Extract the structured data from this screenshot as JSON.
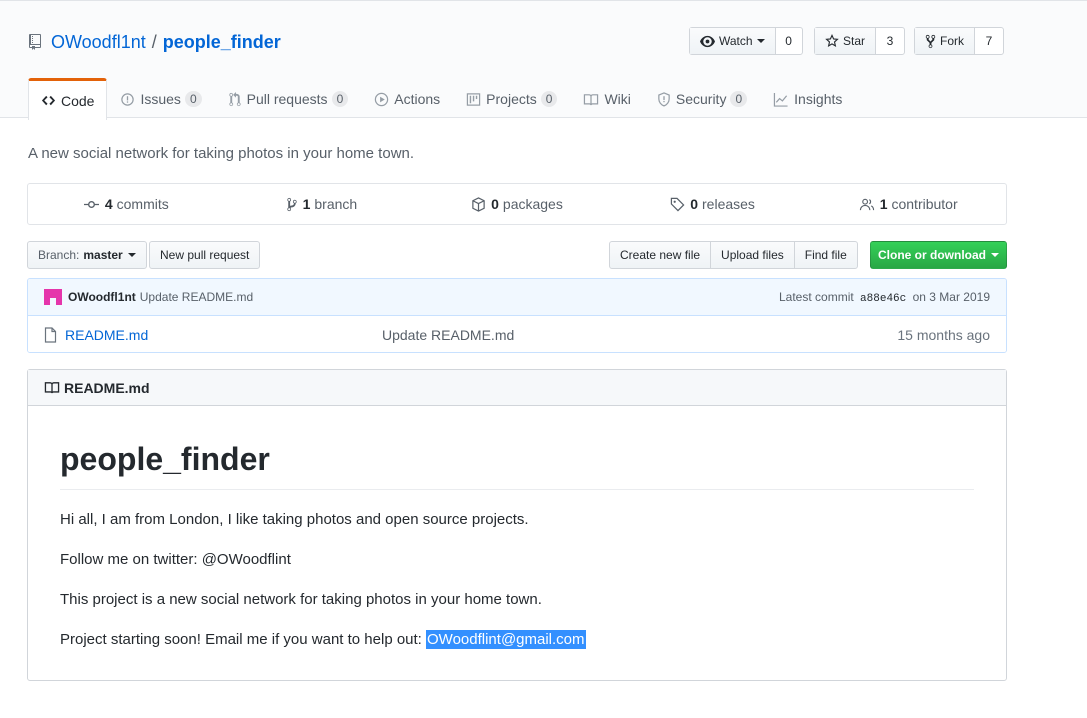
{
  "repo": {
    "owner": "OWoodfl1nt",
    "separator": "/",
    "name": "people_finder"
  },
  "actions": {
    "watch": {
      "label": "Watch",
      "count": "0"
    },
    "star": {
      "label": "Star",
      "count": "3"
    },
    "fork": {
      "label": "Fork",
      "count": "7"
    }
  },
  "tabs": [
    {
      "label": "Code",
      "icon": "code-icon"
    },
    {
      "label": "Issues",
      "count": "0",
      "icon": "issue-icon"
    },
    {
      "label": "Pull requests",
      "count": "0",
      "icon": "pull-request-icon"
    },
    {
      "label": "Actions",
      "icon": "play-icon"
    },
    {
      "label": "Projects",
      "count": "0",
      "icon": "project-icon"
    },
    {
      "label": "Wiki",
      "icon": "book-icon"
    },
    {
      "label": "Security",
      "count": "0",
      "icon": "shield-icon"
    },
    {
      "label": "Insights",
      "icon": "graph-icon"
    }
  ],
  "description": "A new social network for taking photos in your home town.",
  "numbers": {
    "commits": {
      "value": "4",
      "label": "commits"
    },
    "branch": {
      "value": "1",
      "label": "branch"
    },
    "packages": {
      "value": "0",
      "label": "packages"
    },
    "releases": {
      "value": "0",
      "label": "releases"
    },
    "contributor": {
      "value": "1",
      "label": "contributor"
    }
  },
  "toolbar": {
    "branch_prefix": "Branch:",
    "branch_name": "master",
    "new_pr": "New pull request",
    "create_file": "Create new file",
    "upload_files": "Upload files",
    "find_file": "Find file",
    "clone": "Clone or download"
  },
  "commit": {
    "author": "OWoodfl1nt",
    "message": "Update README.md",
    "prefix": "Latest commit",
    "sha": "a88e46c",
    "date": "on 3 Mar 2019"
  },
  "files": [
    {
      "name": "README.md",
      "message": "Update README.md",
      "age": "15 months ago"
    }
  ],
  "readme": {
    "header": "README.md",
    "title": "people_finder",
    "p1": "Hi all, I am from London, I like taking photos and open source projects.",
    "p2": "Follow me on twitter: @OWoodflint",
    "p3": "This project is a new social network for taking photos in your home town.",
    "p4_prefix": "Project starting soon! Email me if you want to help out: ",
    "p4_email": "OWoodflint@gmail.com"
  },
  "colors": {
    "accent_tab": "#e36209",
    "link": "#0366d6",
    "clone_green": "#28a745",
    "selection": "#3390ff",
    "avatar": "#e535ab"
  }
}
